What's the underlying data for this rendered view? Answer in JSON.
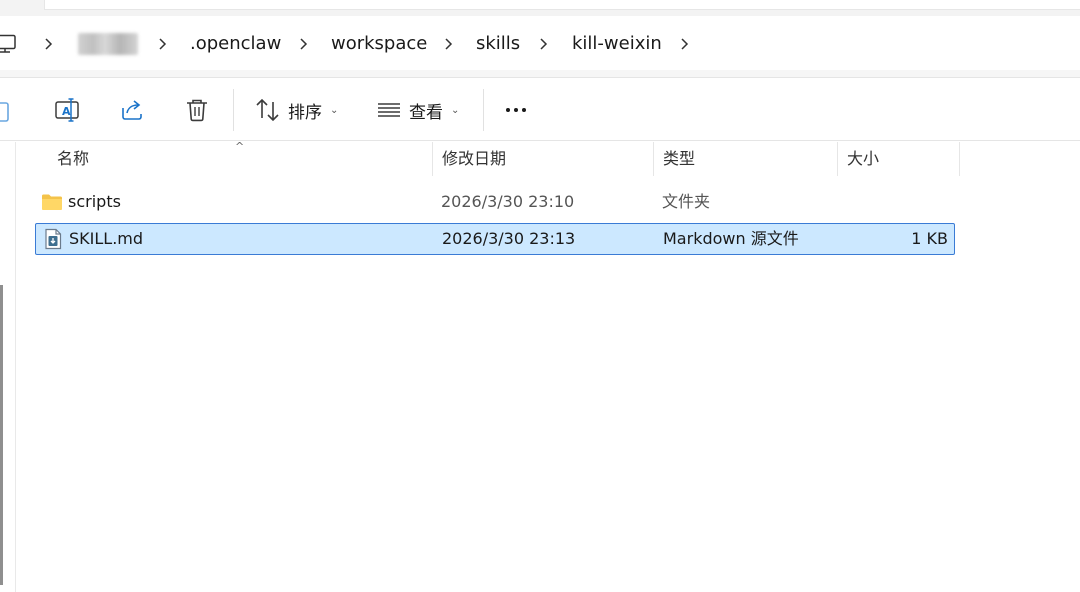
{
  "breadcrumb": {
    "items": [
      ".openclaw",
      "workspace",
      "skills",
      "kill-weixin"
    ]
  },
  "icons": {
    "pc": "computer-icon",
    "chevron": "chevron-right-icon",
    "rename": "rename-icon",
    "share": "share-icon",
    "delete": "trash-icon",
    "sort": "sort-icon",
    "view": "view-list-icon",
    "more": "more-icon",
    "folder": "folder-icon",
    "markdown": "markdown-file-icon"
  },
  "toolbar": {
    "sort_label": "排序",
    "view_label": "查看",
    "more_label": "•••"
  },
  "columns": {
    "name": "名称",
    "date": "修改日期",
    "type": "类型",
    "size": "大小"
  },
  "files": [
    {
      "name": "scripts",
      "date": "2026/3/30 23:10",
      "type": "文件夹",
      "size": "",
      "selected": false
    },
    {
      "name": "SKILL.md",
      "date": "2026/3/30 23:13",
      "type": "Markdown 源文件",
      "size": "1 KB",
      "selected": true
    }
  ],
  "colors": {
    "selection_bg": "#cce8ff",
    "selection_border": "#3a7bd5",
    "folder": "#f4c34a",
    "accent": "#1a73c9"
  }
}
